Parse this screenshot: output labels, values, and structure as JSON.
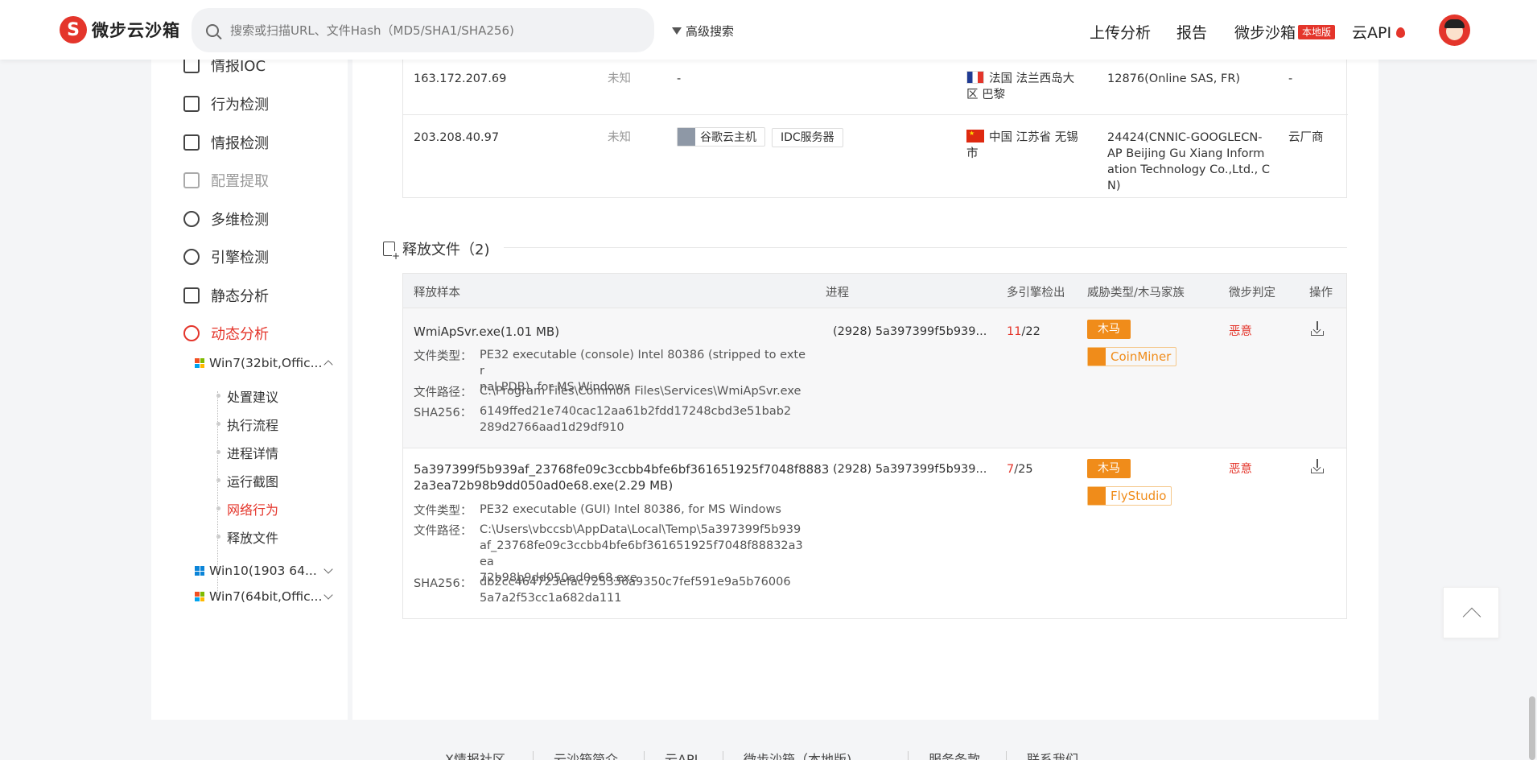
{
  "header": {
    "logo_text": "微步云沙箱",
    "search_placeholder": "搜索或扫描URL、文件Hash（MD5/SHA1/SHA256)",
    "advanced_search": "高级搜索",
    "nav": {
      "upload": "上传分析",
      "report": "报告",
      "sandbox": "微步沙箱",
      "sandbox_badge": "本地版",
      "cloud_api": "云API"
    }
  },
  "sidebar": {
    "items": [
      {
        "label": "情报IOC"
      },
      {
        "label": "行为检测"
      },
      {
        "label": "情报检测"
      },
      {
        "label": "配置提取"
      },
      {
        "label": "多维检测"
      },
      {
        "label": "引擎检测"
      },
      {
        "label": "静态分析"
      },
      {
        "label": "动态分析"
      }
    ],
    "envs": [
      {
        "label": "Win7(32bit,Offic..."
      },
      {
        "label": "Win10(1903 64..."
      },
      {
        "label": "Win7(64bit,Offic..."
      }
    ],
    "tree": [
      {
        "label": "处置建议"
      },
      {
        "label": "执行流程"
      },
      {
        "label": "进程详情"
      },
      {
        "label": "运行截图"
      },
      {
        "label": "网络行为"
      },
      {
        "label": "释放文件"
      }
    ]
  },
  "network_rows": [
    {
      "ip": "163.172.207.69",
      "status": "未知",
      "tags": "-",
      "location_1": "法国 法兰西岛大",
      "location_2": "区 巴黎",
      "asn": "12876(Online SAS, FR)",
      "isp": "-"
    },
    {
      "ip": "203.208.40.97",
      "status": "未知",
      "tag1": "谷歌云主机",
      "tag2": "IDC服务器",
      "location_1": "中国 江苏省 无锡",
      "location_2": "市",
      "asn_1": "24424(CNNIC-GOOGLECN-",
      "asn_2": "AP Beijing Gu Xiang Inform",
      "asn_3": "ation Technology Co.,Ltd., C",
      "asn_4": "N)",
      "isp": "云厂商"
    }
  ],
  "release_section": {
    "title": "释放文件（2)",
    "columns": {
      "sample": "释放样本",
      "process": "进程",
      "engines": "多引擎检出",
      "threat": "威胁类型/木马家族",
      "verdict": "微步判定",
      "action": "操作"
    },
    "labels": {
      "filetype": "文件类型：",
      "filepath": "文件路径：",
      "sha256": "SHA256："
    },
    "rows": [
      {
        "name": "WmiApSvr.exe(1.01 MB)",
        "filetype_1": "PE32 executable (console) Intel 80386 (stripped to exter",
        "filetype_2": "nal PDB), for MS Windows",
        "filepath": "C:\\Program Files\\Common Files\\Services\\WmiApSvr.exe",
        "sha256_1": "6149ffed21e740cac12aa61b2fdd17248cbd3e51bab2",
        "sha256_2": "289d2766aad1d29df910",
        "process": "(2928)  5a397399f5b939...",
        "detect_hits": "11",
        "detect_total": "/22",
        "threat_type": "木马",
        "family": "CoinMiner",
        "verdict": "恶意"
      },
      {
        "name_1": "5a397399f5b939af_23768fe09c3ccbb4bfe6bf361651925f7048f8883",
        "name_2": "2a3ea72b98b9dd050ad0e68.exe(2.29 MB)",
        "filetype_1": "PE32 executable (GUI) Intel 80386, for MS Windows",
        "filepath_1": "C:\\Users\\vbccsb\\AppData\\Local\\Temp\\5a397399f5b939",
        "filepath_2": "af_23768fe09c3ccbb4bfe6bf361651925f7048f88832a3ea",
        "filepath_3": "72b98b9dd050ad0e68.exe",
        "sha256_1": "db2cc464723efac725336a9350c7fef591e9a5b76006",
        "sha256_2": "5a7a2f53cc1a682da111",
        "process": "(2928)  5a397399f5b939...",
        "detect_hits": "7",
        "detect_total": "/25",
        "threat_type": "木马",
        "family": "FlyStudio",
        "verdict": "恶意"
      }
    ]
  },
  "footer": {
    "links": [
      "X情报社区",
      "云沙箱简介",
      "云API",
      "微步沙箱（本地版)",
      "服务条款",
      "联系我们"
    ]
  },
  "colors": {
    "brand_red": "#e4352b",
    "trojan_orange": "#f08c1a"
  }
}
